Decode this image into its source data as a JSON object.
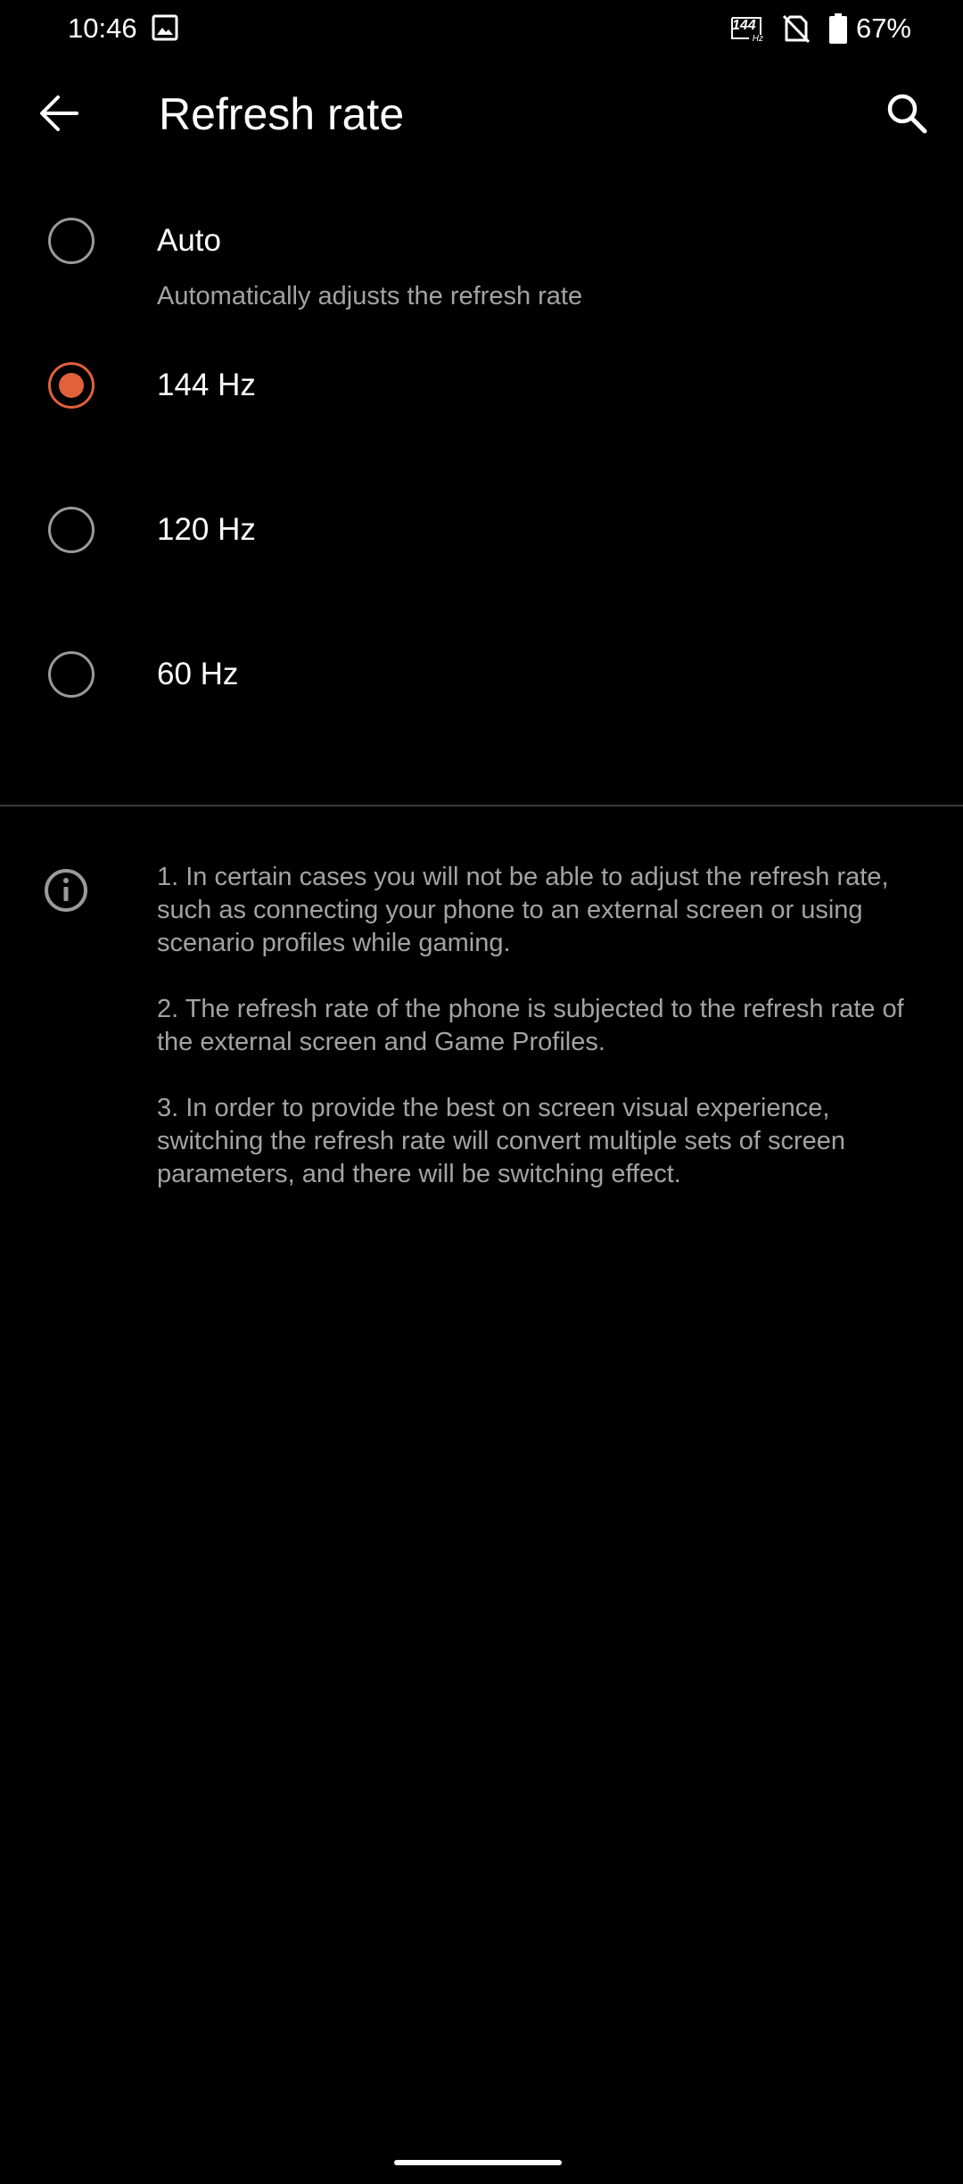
{
  "status_bar": {
    "time": "10:46",
    "refresh_badge_number": "144",
    "refresh_badge_unit": "Hz",
    "battery_percent": "67%",
    "icons": [
      "gallery-icon",
      "refresh-rate-144-icon",
      "no-sim-icon",
      "battery-icon"
    ]
  },
  "app_bar": {
    "title": "Refresh rate",
    "back_icon": "back-arrow-icon",
    "search_icon": "search-icon"
  },
  "options": [
    {
      "label": "Auto",
      "summary": "Automatically adjusts the refresh rate",
      "selected": false
    },
    {
      "label": "144 Hz",
      "selected": true
    },
    {
      "label": "120 Hz",
      "selected": false
    },
    {
      "label": "60 Hz",
      "selected": false
    }
  ],
  "info": {
    "icon": "info-icon",
    "notes": [
      "1. In certain cases you will not be able to adjust the refresh rate, such as connecting your phone to an external screen or using scenario profiles while gaming.",
      "2. The refresh rate of the phone is subjected to the refresh rate of the external screen and Game Profiles.",
      "3. In order to provide the best on screen visual experience, switching the refresh rate will convert multiple sets of screen parameters, and there will be switching effect."
    ]
  },
  "colors": {
    "background": "#000000",
    "accent": "#e0613a",
    "secondary_text": "#a3a3a3",
    "divider": "#3a3a3a"
  }
}
